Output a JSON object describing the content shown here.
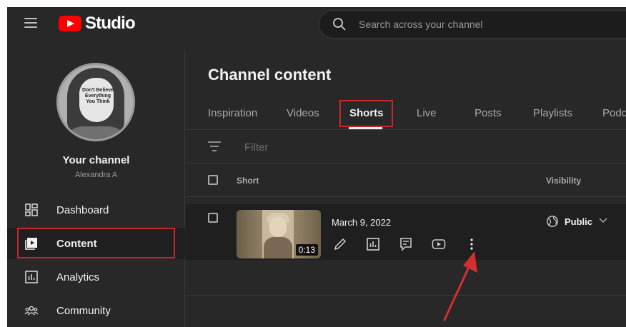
{
  "header": {
    "logo_text": "Studio",
    "search_placeholder": "Search across your channel"
  },
  "sidebar": {
    "channel_name": "Your channel",
    "channel_handle": "Alexandra A",
    "avatar_text": "Don't Believe Everything You Think",
    "items": [
      {
        "label": "Dashboard",
        "icon": "dashboard-icon",
        "active": false
      },
      {
        "label": "Content",
        "icon": "content-icon",
        "active": true
      },
      {
        "label": "Analytics",
        "icon": "analytics-icon",
        "active": false
      },
      {
        "label": "Community",
        "icon": "community-icon",
        "active": false
      }
    ]
  },
  "main": {
    "title": "Channel content",
    "tabs": [
      {
        "label": "Inspiration",
        "active": false
      },
      {
        "label": "Videos",
        "active": false
      },
      {
        "label": "Shorts",
        "active": true
      },
      {
        "label": "Live",
        "active": false
      },
      {
        "label": "Posts",
        "active": false
      },
      {
        "label": "Playlists",
        "active": false
      },
      {
        "label": "Podc",
        "active": false
      }
    ],
    "filter_label": "Filter",
    "columns": {
      "short": "Short",
      "visibility": "Visibility"
    },
    "rows": [
      {
        "date": "March 9, 2022",
        "duration": "0:13",
        "visibility": "Public",
        "actions": [
          "edit-icon",
          "analytics-icon",
          "comments-icon",
          "youtube-icon",
          "more-options-icon"
        ]
      }
    ]
  },
  "colors": {
    "background": "#282828",
    "row_background": "#1f1f1f",
    "highlight": "#c62828",
    "brand_red": "#ff0000",
    "arrow": "#d32f2f"
  }
}
